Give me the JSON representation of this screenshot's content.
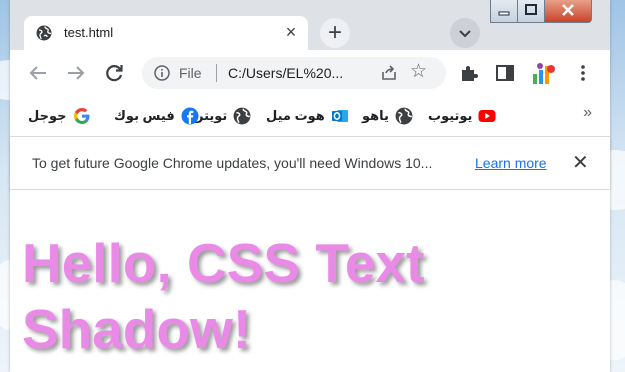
{
  "tab": {
    "title": "test.html",
    "close_icon": "×"
  },
  "newtab_icon": "+",
  "toolbar": {
    "scheme": "File",
    "url": "C:/Users/EL%20...",
    "star_icon": "☆"
  },
  "bookmarks": [
    {
      "label": "جوجل",
      "icon": "google-icon"
    },
    {
      "label": "فيس بوك",
      "icon": "facebook-icon"
    },
    {
      "label": "تويتر",
      "icon": "globe-icon"
    },
    {
      "label": "هوت ميل",
      "icon": "outlook-icon"
    },
    {
      "label": "ياهو",
      "icon": "globe-icon"
    },
    {
      "label": "يوتيوب",
      "icon": "youtube-icon"
    }
  ],
  "bookmarks_more": "»",
  "infobar": {
    "message": "To get future Google Chrome updates, you'll need Windows 10...",
    "link": "Learn more",
    "close": "✕"
  },
  "page": {
    "line1": "Hello, CSS Text",
    "line2": "Shadow!",
    "text_color": "#e98ae6",
    "shadow_color": "#9a9a9a"
  },
  "colors": {
    "tabstrip": "#dee1e6",
    "link": "#1a73e8",
    "youtube": "#ff0000",
    "facebook": "#1877f2",
    "outlook": "#0078d4"
  }
}
